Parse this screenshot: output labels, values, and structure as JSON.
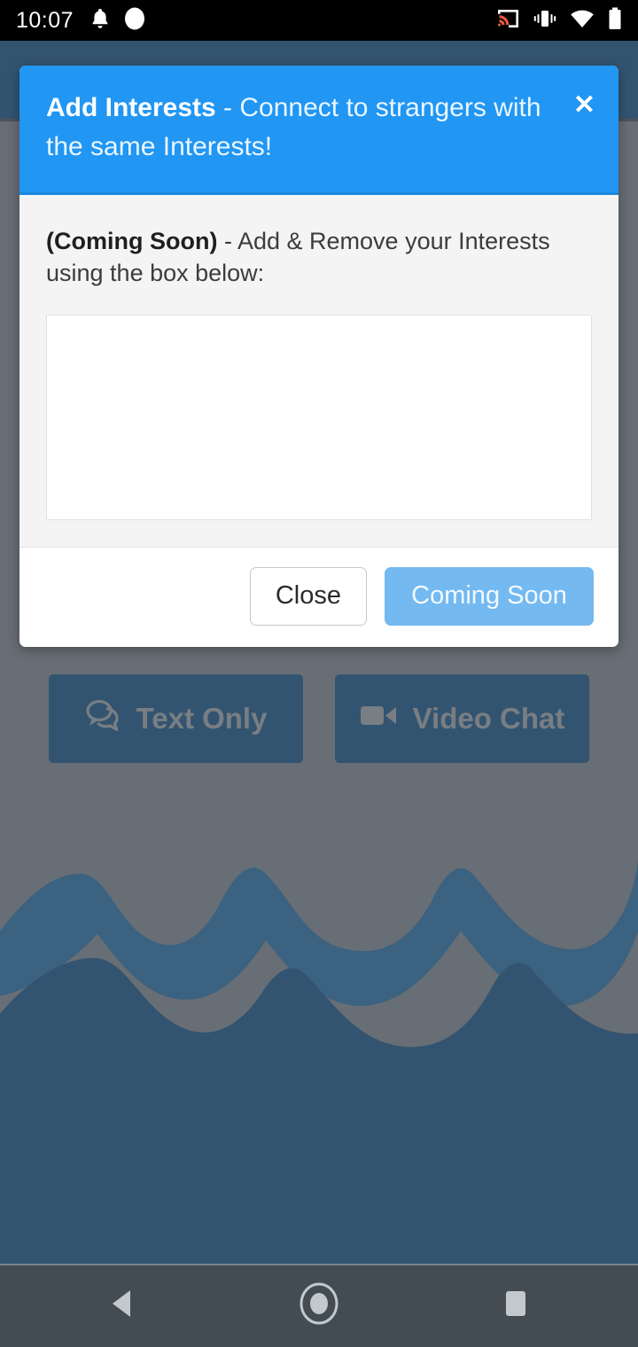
{
  "status_bar": {
    "time": "10:07",
    "left_icons": [
      {
        "name": "notification-bell-icon"
      },
      {
        "name": "circle-indicator-icon"
      }
    ],
    "right_icons": [
      {
        "name": "cast-screen-icon",
        "accent": "#e8593a"
      },
      {
        "name": "vibrate-mode-icon"
      },
      {
        "name": "wifi-icon"
      },
      {
        "name": "battery-icon"
      }
    ],
    "background": "#000000"
  },
  "modal": {
    "header": {
      "title_bold": "Add Interests",
      "title_rest": " - Connect to strangers with the same Interests!",
      "close_label": "✕",
      "background": "#2196f3"
    },
    "body": {
      "text_bold": "(Coming Soon)",
      "text_rest": " - Add & Remove your Interests using the box below:",
      "input_value": "",
      "input_placeholder": "",
      "background": "#f4f4f4"
    },
    "footer": {
      "close_label": "Close",
      "primary_label": "Coming Soon",
      "primary_color": "#74b9f0"
    }
  },
  "background_app": {
    "buttons": [
      {
        "label": "Text Only",
        "icon": "comments-icon",
        "color": "#1d5582"
      },
      {
        "label": "Video Chat",
        "icon": "video-camera-icon",
        "color": "#1d5582"
      }
    ],
    "wave_color_light": "#2a6d9e",
    "wave_color_dark": "#1d5582",
    "page_background": "#7d848b"
  },
  "nav_bar": {
    "background": "#434c52",
    "buttons": [
      {
        "name": "back-button",
        "icon": "triangle-left-icon"
      },
      {
        "name": "home-button",
        "icon": "circle-icon"
      },
      {
        "name": "recents-button",
        "icon": "square-icon"
      }
    ]
  }
}
